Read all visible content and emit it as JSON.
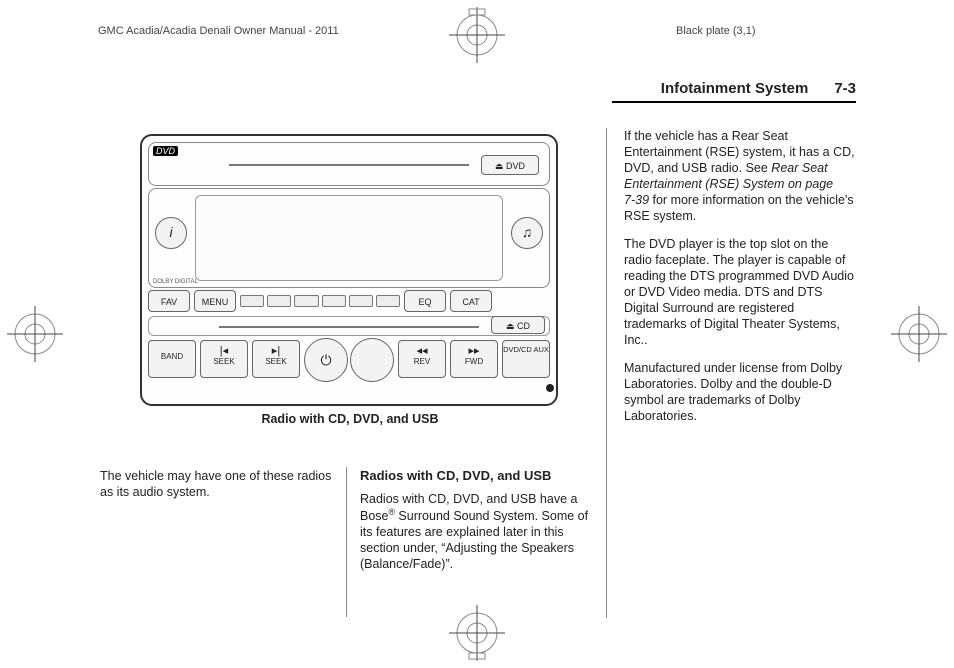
{
  "header": {
    "doc_title": "GMC Acadia/Acadia Denali Owner Manual - 2011",
    "plate": "Black plate (3,1)"
  },
  "running_head": {
    "section": "Infotainment System",
    "page": "7-3"
  },
  "figure": {
    "caption": "Radio with CD, DVD, and USB",
    "buttons": {
      "dvd_label": "DVD",
      "eject_dvd": "⏏ DVD",
      "info_btn": "i",
      "dolby": "DOLBY DIGITAL",
      "music_btn": "♫",
      "fav": "FAV",
      "menu": "MENU",
      "eq": "EQ",
      "cat": "CAT",
      "eject_cd": "⏏ CD",
      "band": "BAND",
      "seek_l_sym": "|◂",
      "seek_l": "SEEK",
      "seek_r_sym": "▸|",
      "seek_r": "SEEK",
      "power": "⏻",
      "rev_sym": "◂◂",
      "rev": "REV",
      "fwd_sym": "▸▸",
      "fwd": "FWD",
      "dvdcd": "DVD/CD AUX"
    }
  },
  "col1": {
    "p1": "The vehicle may have one of these radios as its audio system."
  },
  "col2": {
    "h": "Radios with CD, DVD, and USB",
    "p1a": "Radios with CD, DVD, and USB have a Bose",
    "p1b": " Surround Sound System. Some of its features are explained later in this section under, “Adjusting the Speakers (Balance/Fade)”."
  },
  "col3": {
    "p1a": "If the vehicle has a Rear Seat Entertainment (RSE) system, it has a CD, DVD, and USB radio. See ",
    "p1b": "Rear Seat Entertainment (RSE) System on page 7‑39",
    "p1c": " for more information on the vehicle's RSE system.",
    "p2": "The DVD player is the top slot on the radio faceplate. The player is capable of reading the DTS programmed DVD Audio or DVD Video media. DTS and DTS Digital Surround are registered trademarks of Digital Theater Systems, Inc..",
    "p3": "Manufactured under license from Dolby Laboratories. Dolby and the double-D symbol are trademarks of Dolby Laboratories."
  }
}
